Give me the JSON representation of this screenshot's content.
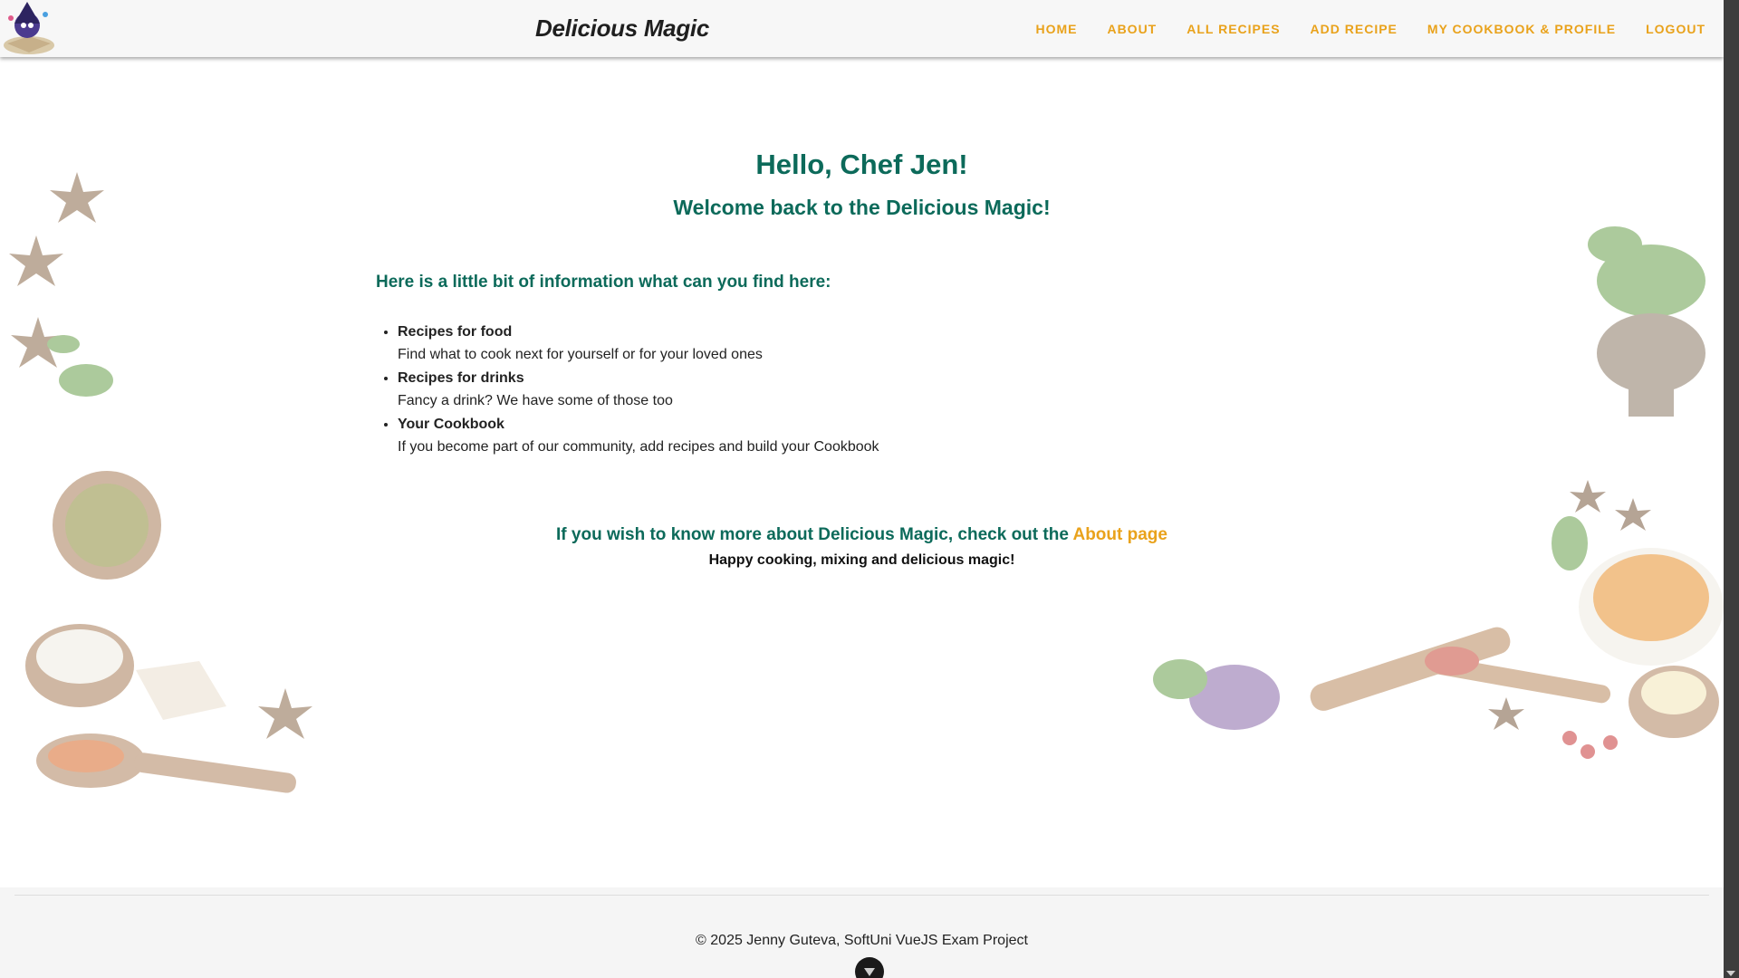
{
  "app": {
    "brand": "Delicious Magic",
    "logo_icon": "wizard-cookbook-logo"
  },
  "nav": {
    "items": [
      {
        "label": "HOME"
      },
      {
        "label": "ABOUT"
      },
      {
        "label": "ALL RECIPES"
      },
      {
        "label": "ADD RECIPE"
      },
      {
        "label": "MY COOKBOOK & PROFILE"
      },
      {
        "label": "LOGOUT"
      }
    ]
  },
  "main": {
    "greeting": "Hello, Chef Jen!",
    "welcome": "Welcome back to the Delicious Magic!",
    "info_title": "Here is a little bit of information what can you find here:",
    "features": [
      {
        "title": "Recipes for food",
        "desc": "Find what to cook next for yourself or for your loved ones"
      },
      {
        "title": "Recipes for drinks",
        "desc": "Fancy a drink? We have some of those too"
      },
      {
        "title": "Your Cookbook",
        "desc": "If you become part of our community, add recipes and build your Cookbook"
      }
    ],
    "about_prefix": "If you wish to know more about Delicious Magic, check out the ",
    "about_link": "About page",
    "closing": "Happy cooking, mixing and delicious magic!"
  },
  "footer": {
    "copyright": "© 2025 Jenny Guteva, SoftUni VueJS Exam Project"
  },
  "colors": {
    "accent": "#e9a21b",
    "heading": "#0c6a5a",
    "header_bg": "#f7f7f7",
    "footer_bg": "#f5f5f5"
  }
}
